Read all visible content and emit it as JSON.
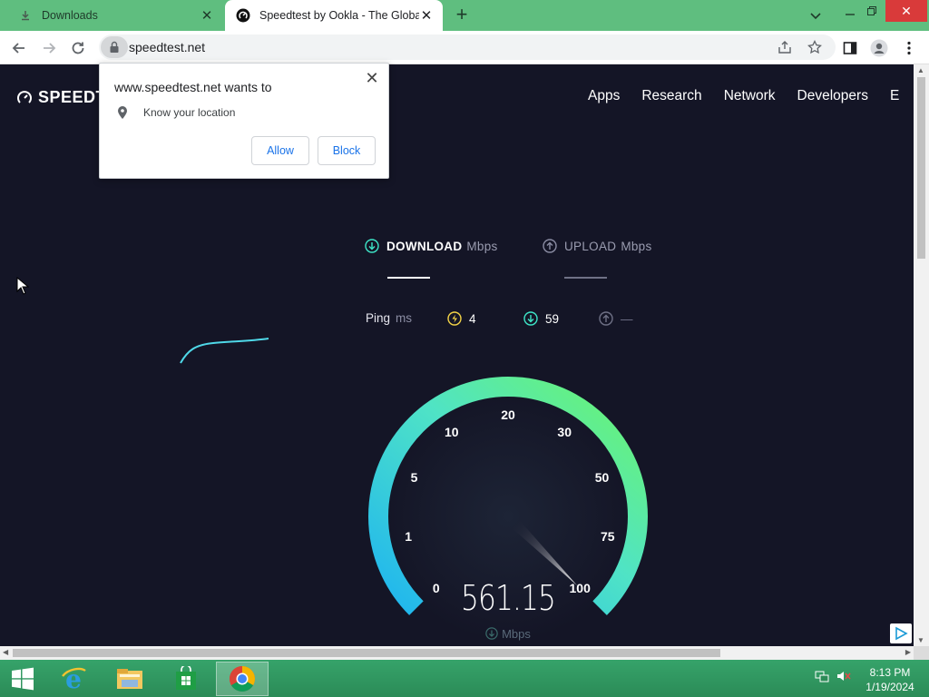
{
  "browser": {
    "tabs": [
      {
        "title": "Downloads",
        "icon": "download-icon",
        "active": false
      },
      {
        "title": "Speedtest by Ookla - The Global",
        "icon": "speedtest-icon",
        "active": true
      }
    ],
    "url": "speedtest.net"
  },
  "site": {
    "logo_text": "SPEEDT",
    "nav": [
      "Apps",
      "Research",
      "Network",
      "Developers",
      "E"
    ]
  },
  "metrics": {
    "download_label": "DOWNLOAD",
    "download_unit": "Mbps",
    "upload_label": "UPLOAD",
    "upload_unit": "Mbps"
  },
  "ping": {
    "label": "Ping",
    "unit": "ms",
    "idle": "4",
    "download": "59",
    "upload": "—"
  },
  "gauge": {
    "ticks": [
      "0",
      "1",
      "5",
      "10",
      "20",
      "30",
      "50",
      "75",
      "100"
    ],
    "value": "561.15",
    "unit": "Mbps",
    "needle_fraction": 1.0
  },
  "popup": {
    "title": "www.speedtest.net wants to",
    "permission": "Know your location",
    "allow_label": "Allow",
    "block_label": "Block"
  },
  "taskbar": {
    "time": "8:13 PM",
    "date": "1/19/2024"
  },
  "colors": {
    "page_bg": "#141526",
    "tab_strip": "#5fbe7f",
    "gauge_start": "#1eb4f0",
    "gauge_end": "#6cf56c",
    "link_blue": "#1a73e8"
  }
}
